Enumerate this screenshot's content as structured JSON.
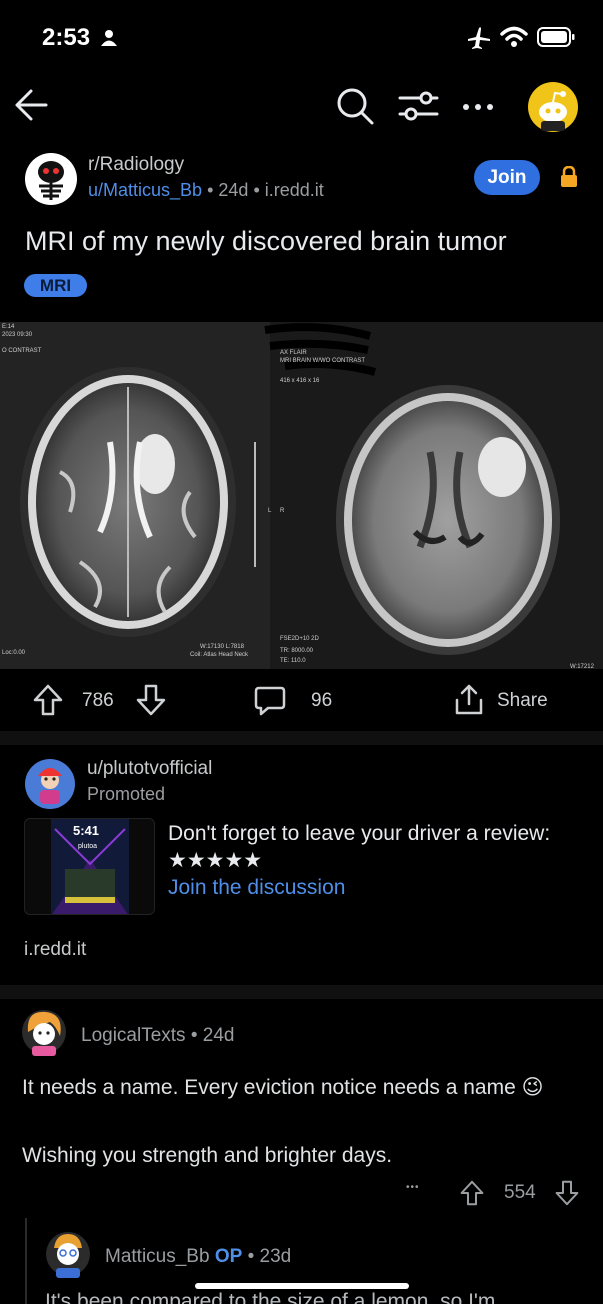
{
  "status_bar": {
    "time": "2:53"
  },
  "post": {
    "subreddit": "r/Radiology",
    "author": "u/Matticus_Bb",
    "age": "24d",
    "domain": "i.redd.it",
    "join_label": "Join",
    "title": "MRI of my newly discovered brain tumor",
    "flair": "MRI",
    "upvotes": "786",
    "comments": "96",
    "share_label": "Share"
  },
  "ad": {
    "user": "u/plutotvofficial",
    "promoted": "Promoted",
    "text": "Don't forget to leave your driver a review: ★★★★★",
    "link": "Join the discussion",
    "domain": "i.redd.it",
    "thumb_time": "5:41",
    "thumb_brand": "plutoa"
  },
  "comment": {
    "user": "LogicalTexts",
    "age": "24d",
    "body": "It needs a name. Every eviction notice needs a name 😉",
    "body2": "Wishing you strength and brighter days.",
    "more": "•••",
    "votes": "554"
  },
  "reply": {
    "user": "Matticus_Bb",
    "op_label": "OP",
    "age": "23d",
    "body": "It's been compared to the size of a lemon, so I'm"
  },
  "colors": {
    "accent": "#2f6fe0",
    "link": "#4f8fe8",
    "lock": "#f5a623",
    "avatar": "#f0c419"
  }
}
